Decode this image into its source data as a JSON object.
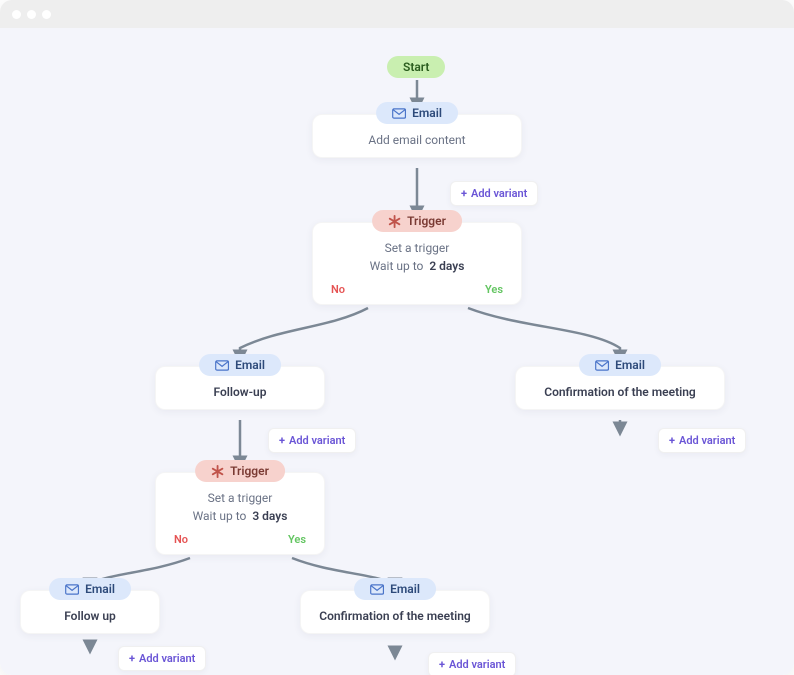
{
  "start": {
    "label": "Start"
  },
  "nodes": {
    "email1": {
      "pill": "Email",
      "body": "Add email content"
    },
    "trigger1": {
      "pill": "Trigger",
      "line1": "Set a trigger",
      "wait_prefix": "Wait up to",
      "wait_value": "2 days",
      "no": "No",
      "yes": "Yes"
    },
    "email_followup": {
      "pill": "Email",
      "body": "Follow-up"
    },
    "email_confirm1": {
      "pill": "Email",
      "body": "Confirmation of the meeting"
    },
    "trigger2": {
      "pill": "Trigger",
      "line1": "Set a trigger",
      "wait_prefix": "Wait up to",
      "wait_value": "3 days",
      "no": "No",
      "yes": "Yes"
    },
    "email_followup2": {
      "pill": "Email",
      "body": "Follow up"
    },
    "email_confirm2": {
      "pill": "Email",
      "body": "Confirmation of the meeting"
    }
  },
  "buttons": {
    "add_variant": "Add variant"
  },
  "colors": {
    "accent_purple": "#6a55d6",
    "pill_green": "#c9efb0",
    "pill_blue": "#dce8fb",
    "pill_red": "#f7d2cd",
    "arrow": "#7c8895"
  }
}
